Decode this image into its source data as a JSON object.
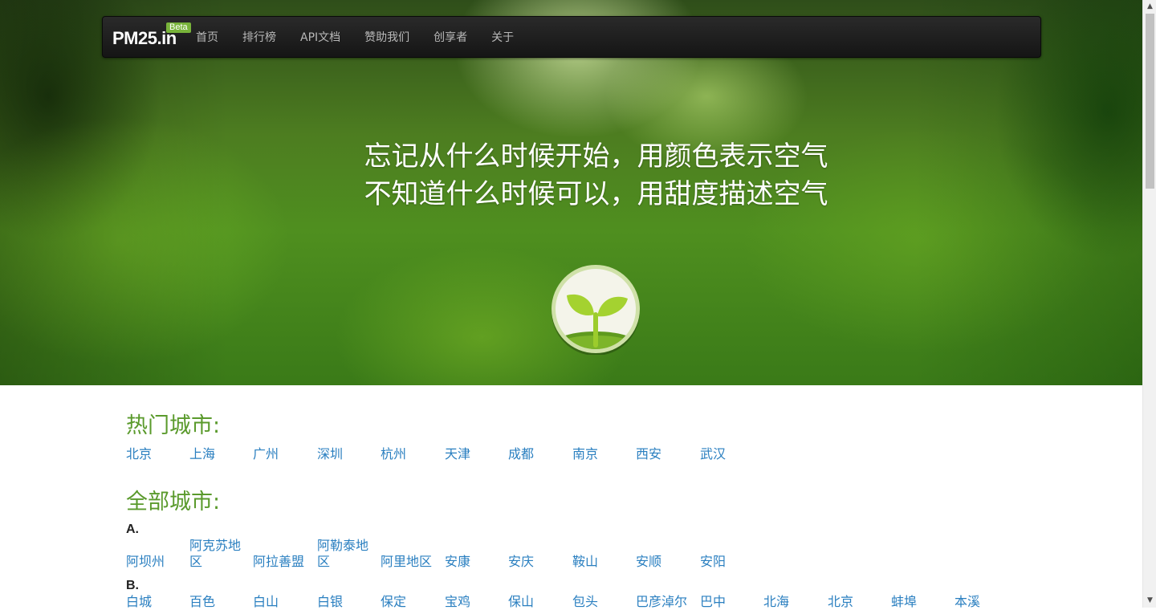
{
  "brand": {
    "name": "PM25.in",
    "badge": "Beta"
  },
  "nav": [
    "首页",
    "排行榜",
    "API文档",
    "赞助我们",
    "创享者",
    "关于"
  ],
  "slogan": {
    "line1": "忘记从什么时候开始，用颜色表示空气",
    "line2": "不知道什么时候可以，用甜度描述空气"
  },
  "hot": {
    "title": "热门城市:",
    "cities": [
      "北京",
      "上海",
      "广州",
      "深圳",
      "杭州",
      "天津",
      "成都",
      "南京",
      "西安",
      "武汉"
    ]
  },
  "all": {
    "title": "全部城市:",
    "groups": [
      {
        "letter": "A.",
        "cities": [
          "阿坝州",
          "阿克苏地区",
          "阿拉善盟",
          "阿勒泰地区",
          "阿里地区",
          "安康",
          "安庆",
          "鞍山",
          "安顺",
          "安阳"
        ]
      },
      {
        "letter": "B.",
        "cities": [
          "白城",
          "百色",
          "白山",
          "白银",
          "保定",
          "宝鸡",
          "保山",
          "包头",
          "巴彦淖尔",
          "巴中",
          "北海",
          "北京",
          "蚌埠",
          "本溪"
        ]
      }
    ]
  },
  "colors": {
    "accent": "#5a9a2c",
    "link": "#2a7fc0",
    "nav_bg": "#1b1b1b",
    "badge": "#78b33a"
  },
  "icons": [
    "sprout-logo-icon",
    "scroll-up-icon",
    "scroll-down-icon"
  ]
}
